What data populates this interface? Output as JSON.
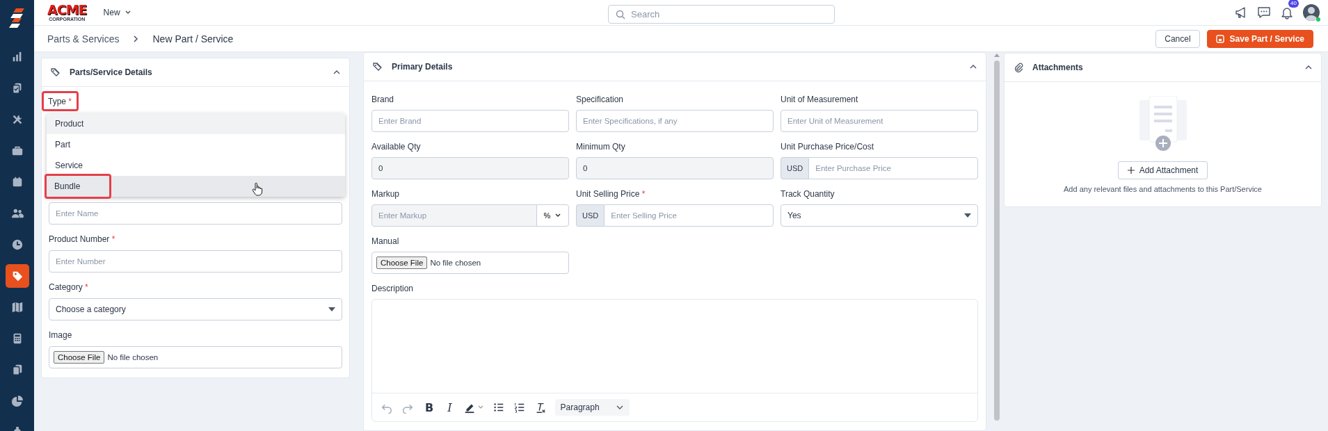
{
  "sidebar": {
    "items": [
      {
        "selected": false
      },
      {
        "selected": false
      },
      {
        "selected": false
      },
      {
        "selected": false
      },
      {
        "selected": false
      },
      {
        "selected": false
      },
      {
        "selected": false
      },
      {
        "selected": true
      },
      {
        "selected": false
      },
      {
        "selected": false
      },
      {
        "selected": false
      },
      {
        "selected": false
      },
      {
        "selected": false
      }
    ]
  },
  "topbar": {
    "logo_text": "ACME",
    "logo_subtext": "CORPORATION",
    "new_menu": "New",
    "search": {
      "placeholder": "Search"
    },
    "notifications_badge": "40",
    "user": {
      "online": true
    }
  },
  "breadcrumb": [
    "Parts & Services",
    "New Part / Service"
  ],
  "actions": [
    {
      "label": "Cancel",
      "kind": "secondary"
    },
    {
      "label": "Save Part / Service",
      "kind": "primary"
    }
  ],
  "details_card": {
    "title": "Parts/Service Details",
    "expanded": true,
    "type_field": {
      "label": "Type",
      "required_mark": "*",
      "highlighted": true,
      "options": [
        {
          "label": "Product",
          "selected": true,
          "hovered": false,
          "highlighted": false
        },
        {
          "label": "Part",
          "selected": false,
          "hovered": false,
          "highlighted": false
        },
        {
          "label": "Service",
          "selected": false,
          "hovered": false,
          "highlighted": false
        },
        {
          "label": "Bundle",
          "selected": false,
          "hovered": true,
          "highlighted": true
        }
      ]
    },
    "fields": [
      {
        "kind": "text",
        "placeholder": "Enter Name",
        "disabled": false
      },
      {
        "kind": "text",
        "label": "Product Number",
        "required_mark": "*",
        "placeholder": "Enter Number",
        "disabled": false
      },
      {
        "kind": "select",
        "label": "Category",
        "required_mark": "*",
        "value": "Choose a category"
      },
      {
        "kind": "file",
        "label": "Image",
        "button": "Choose File",
        "value": "No file chosen"
      }
    ]
  },
  "primary_card": {
    "title": "Primary Details",
    "expanded": true,
    "fields": [
      {
        "kind": "text",
        "label": "Brand",
        "placeholder": "Enter Brand",
        "disabled": false
      },
      {
        "kind": "text",
        "label": "Specification",
        "placeholder": "Enter Specifications, if any",
        "disabled": false
      },
      {
        "kind": "text",
        "label": "Unit of Measurement",
        "placeholder": "Enter Unit of Measurement",
        "disabled": false
      },
      {
        "kind": "text",
        "label": "Available Qty",
        "value": "0",
        "disabled": true
      },
      {
        "kind": "text",
        "label": "Minimum Qty",
        "value": "0",
        "disabled": true
      },
      {
        "kind": "currency",
        "label": "Unit Purchase Price/Cost",
        "prefix": "USD",
        "placeholder": "Enter Purchase Price"
      },
      {
        "kind": "markup",
        "label": "Markup",
        "placeholder": "Enter Markup",
        "unit": "%",
        "disabled": true
      },
      {
        "kind": "currency",
        "label": "Unit Selling Price",
        "required_mark": "*",
        "prefix": "USD",
        "placeholder": "Enter Selling Price"
      },
      {
        "kind": "select",
        "label": "Track Quantity",
        "value": "Yes"
      },
      {
        "kind": "file",
        "label": "Manual",
        "button": "Choose File",
        "value": "No file chosen"
      }
    ],
    "description": {
      "label": "Description",
      "toolbar": [
        {
          "kind": "undo",
          "disabled": true
        },
        {
          "kind": "redo",
          "disabled": true
        },
        {
          "kind": "bold",
          "glyph": "B",
          "disabled": false
        },
        {
          "kind": "italic",
          "glyph": "I",
          "disabled": false
        },
        {
          "kind": "highlight",
          "disabled": false
        },
        {
          "kind": "bullets",
          "disabled": false
        },
        {
          "kind": "numbers",
          "disabled": false
        },
        {
          "kind": "clear",
          "disabled": false
        }
      ],
      "block_format": "Paragraph"
    }
  },
  "attachments_card": {
    "title": "Attachments",
    "expanded": true,
    "button": "Add Attachment",
    "hint": "Add any relevant files and attachments to this Part/Service"
  }
}
